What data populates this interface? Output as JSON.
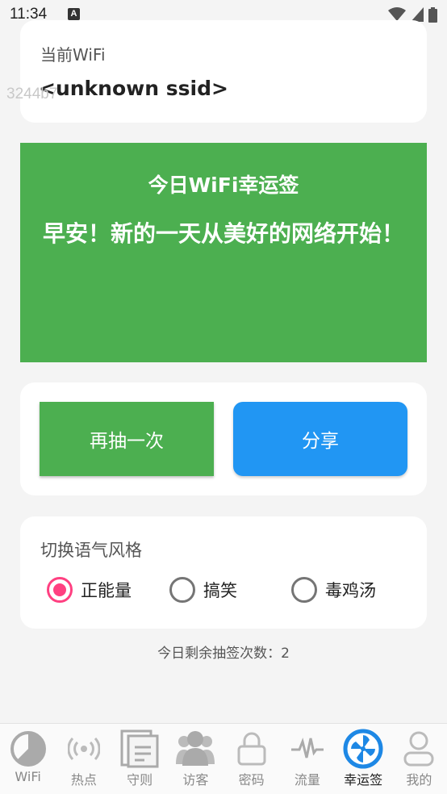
{
  "status_bar": {
    "time": "11:34",
    "notification_icon": "a-icon",
    "icons": [
      "wifi-icon",
      "signal-icon",
      "battery-icon"
    ]
  },
  "wifi_card": {
    "label": "当前WiFi",
    "ssid": "<unknown ssid>"
  },
  "overlay_text": "3244b7",
  "fortune": {
    "title": "今日WiFi幸运签",
    "text": "早安！新的一天从美好的网络开始！"
  },
  "actions": {
    "redraw_label": "再抽一次",
    "share_label": "分享"
  },
  "tone": {
    "title": "切换语气风格",
    "options": [
      {
        "label": "正能量",
        "selected": true
      },
      {
        "label": "搞笑",
        "selected": false
      },
      {
        "label": "毒鸡汤",
        "selected": false
      }
    ]
  },
  "draw_count_text": "今日剩余抽签次数：2",
  "nav": {
    "items": [
      {
        "label": "WiFi",
        "icon": "pie-chart-icon",
        "active": false
      },
      {
        "label": "热点",
        "icon": "hotspot-icon",
        "active": false
      },
      {
        "label": "守则",
        "icon": "document-icon",
        "active": false
      },
      {
        "label": "访客",
        "icon": "users-icon",
        "active": false
      },
      {
        "label": "密码",
        "icon": "lock-icon",
        "active": false
      },
      {
        "label": "流量",
        "icon": "pulse-icon",
        "active": false
      },
      {
        "label": "幸运签",
        "icon": "fan-icon",
        "active": true
      },
      {
        "label": "我的",
        "icon": "person-icon",
        "active": false
      }
    ]
  },
  "colors": {
    "green": "#4caf50",
    "blue": "#2196f3",
    "radio_accent": "#ff4081",
    "active_nav": "#1e88e5"
  }
}
